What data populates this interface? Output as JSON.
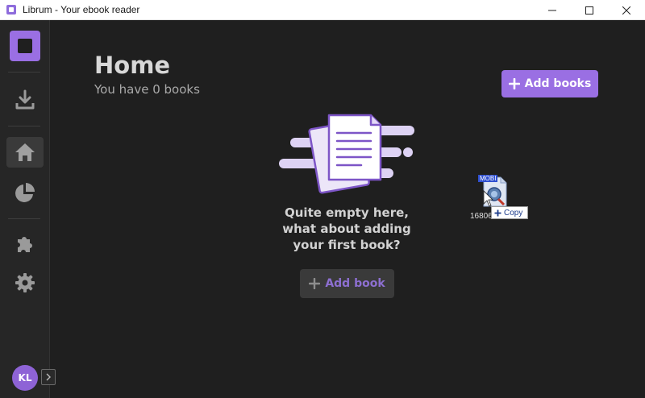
{
  "window": {
    "title": "Librum - Your ebook reader"
  },
  "sidebar": {
    "items": [
      {
        "id": "downloads",
        "icon": "download-icon"
      },
      {
        "id": "home",
        "icon": "home-icon",
        "active": true
      },
      {
        "id": "statistics",
        "icon": "pie-chart-icon"
      },
      {
        "id": "plugins",
        "icon": "puzzle-icon"
      },
      {
        "id": "settings",
        "icon": "gear-icon"
      }
    ],
    "user_initials": "KL"
  },
  "main": {
    "title": "Home",
    "subtitle": "You have 0 books",
    "add_books_label": "Add books",
    "empty_message": "Quite empty here, what about adding your first book?",
    "add_book_label": "Add book"
  },
  "drag_ghost": {
    "file_type": "MOBI",
    "file_name": "16806",
    "action_label": "Copy"
  },
  "colors": {
    "accent": "#9a6fe3",
    "background": "#1f1f1f",
    "sidebar": "#262626"
  }
}
